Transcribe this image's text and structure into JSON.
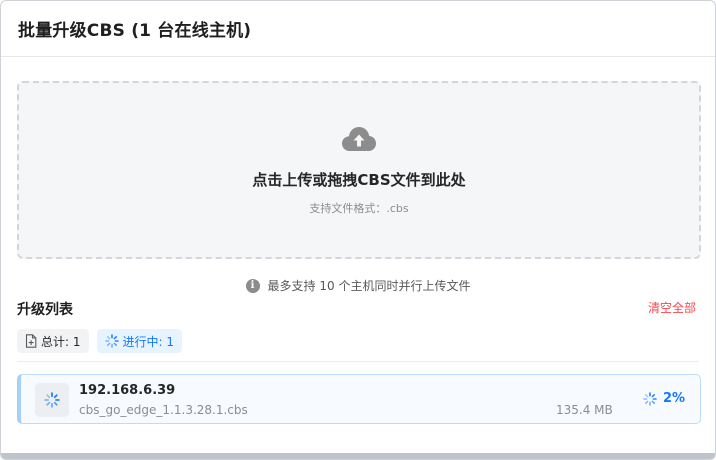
{
  "dialog": {
    "title": "批量升级CBS (1 台在线主机)"
  },
  "upload": {
    "title": "点击上传或拖拽CBS文件到此处",
    "hint": "支持文件格式：.cbs",
    "icon": "cloud-upload-icon"
  },
  "notice": {
    "icon": "info-icon",
    "text": "最多支持 10 个主机同时并行上传文件"
  },
  "list": {
    "title": "升级列表",
    "clear_all": "清空全部",
    "tags": {
      "total": "总计: 1",
      "in_progress": "进行中: 1"
    },
    "items": [
      {
        "ip": "192.168.6.39",
        "file": "cbs_go_edge_1.1.3.28.1.cbs",
        "size": "135.4 MB",
        "progress_text": "2%",
        "progress": 0.02
      }
    ]
  },
  "colors": {
    "accent": "#1677ff",
    "danger": "#f5484d",
    "dropzone_bg": "#f5f6f7",
    "dashed_border": "#d2d6db"
  }
}
